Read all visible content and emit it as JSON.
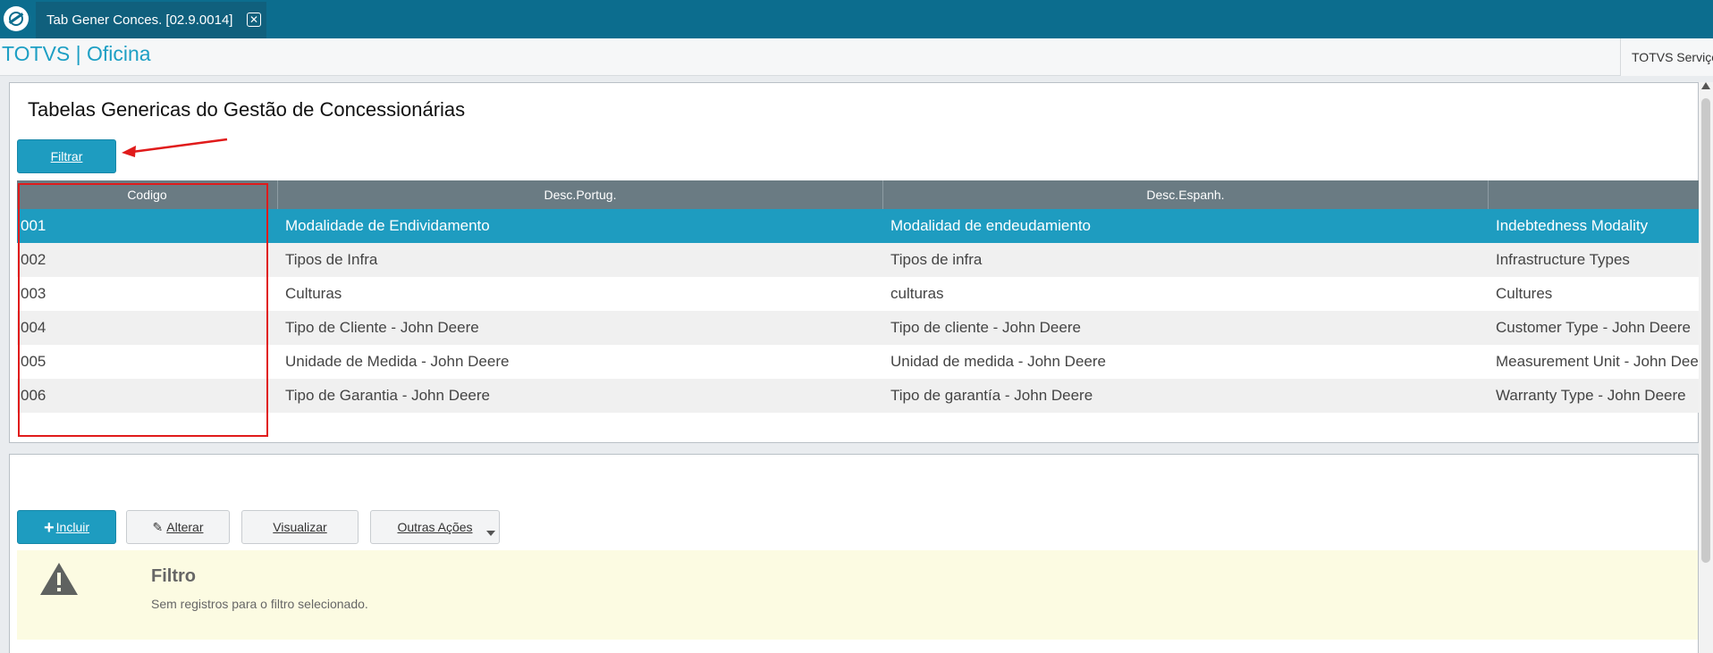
{
  "tab": {
    "label": "Tab Gener Conces. [02.9.0014]",
    "close_glyph": "✕"
  },
  "app": {
    "title": "TOTVS | Oficina",
    "right_label": "TOTVS Serviços"
  },
  "panel": {
    "title": "Tabelas Genericas do Gestão de Concessionárias",
    "filter_button": "Filtrar"
  },
  "grid": {
    "columns": [
      "Codigo",
      "Desc.Portug.",
      "Desc.Espanh.",
      ""
    ],
    "rows": [
      [
        "001",
        "Modalidade de Endividamento",
        "Modalidad de endeudamiento",
        "Indebtedness Modality"
      ],
      [
        "002",
        "Tipos de Infra",
        "Tipos de infra",
        "Infrastructure Types"
      ],
      [
        "003",
        "Culturas",
        "culturas",
        "Cultures"
      ],
      [
        "004",
        "Tipo de Cliente - John Deere",
        "Tipo de cliente - John Deere",
        "Customer Type - John Deere"
      ],
      [
        "005",
        "Unidade de Medida - John Deere",
        "Unidad de medida - John Deere",
        "Measurement Unit - John Deere"
      ],
      [
        "006",
        "Tipo de Garantia - John Deere",
        "Tipo de garantía - John Deere",
        "Warranty Type - John Deere"
      ]
    ],
    "selected_row": 0
  },
  "actions": {
    "incluir": "Incluir",
    "alterar": "Alterar",
    "visualizar": "Visualizar",
    "outras": "Outras Ações"
  },
  "notice": {
    "title": "Filtro",
    "message": "Sem registros para o filtro selecionado."
  },
  "colors": {
    "topbar": "#0c6d8e",
    "accent": "#1e9cc0",
    "header": "#6a7b83",
    "highlight": "#e01b1b",
    "notice_bg": "#fcfbe2"
  }
}
